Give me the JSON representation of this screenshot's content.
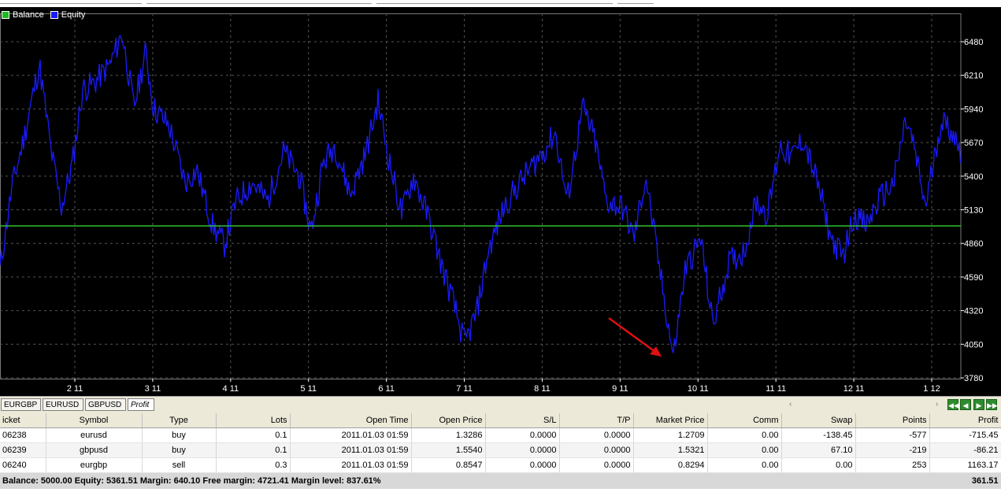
{
  "chart": {
    "legend": [
      {
        "label": "Balance",
        "color": "#22b822"
      },
      {
        "label": "Equity",
        "color": "#1a1aff"
      }
    ],
    "y_ticks": [
      "6480",
      "6210",
      "5940",
      "5670",
      "5400",
      "5130",
      "4860",
      "4590",
      "4320",
      "4050",
      "3780"
    ],
    "x_ticks": [
      "2 11",
      "3 11",
      "4 11",
      "5 11",
      "6 11",
      "7 11",
      "8 11",
      "9 11",
      "10 11",
      "11 11",
      "12 11",
      "1 12"
    ],
    "balance_value": 5000,
    "colors": {
      "background": "#000000",
      "grid": "#555555",
      "annotation_arrow": "#e01010"
    }
  },
  "tabs": [
    "EURGBP",
    "EURUSD",
    "GBPUSD",
    "Profit"
  ],
  "active_tab": "Profit",
  "table": {
    "headers": [
      "icket",
      "Symbol",
      "Type",
      "Lots",
      "Open Time",
      "Open Price",
      "S/L",
      "T/P",
      "Market Price",
      "Comm",
      "Swap",
      "Points",
      "Profit"
    ],
    "rows": [
      [
        "06238",
        "eurusd",
        "buy",
        "0.1",
        "2011.01.03 01:59",
        "1.3286",
        "0.0000",
        "0.0000",
        "1.2709",
        "0.00",
        "-138.45",
        "-577",
        "-715.45"
      ],
      [
        "06239",
        "gbpusd",
        "buy",
        "0.1",
        "2011.01.03 01:59",
        "1.5540",
        "0.0000",
        "0.0000",
        "1.5321",
        "0.00",
        "67.10",
        "-219",
        "-86.21"
      ],
      [
        "06240",
        "eurgbp",
        "sell",
        "0.3",
        "2011.01.03 01:59",
        "0.8547",
        "0.0000",
        "0.0000",
        "0.8294",
        "0.00",
        "0.00",
        "253",
        "1163.17"
      ]
    ],
    "summary_text": "Balance: 5000.00 Equity: 5361.51 Margin: 640.10 Free margin: 4721.41 Margin level: 837.61%",
    "summary_profit": "361.51"
  }
}
